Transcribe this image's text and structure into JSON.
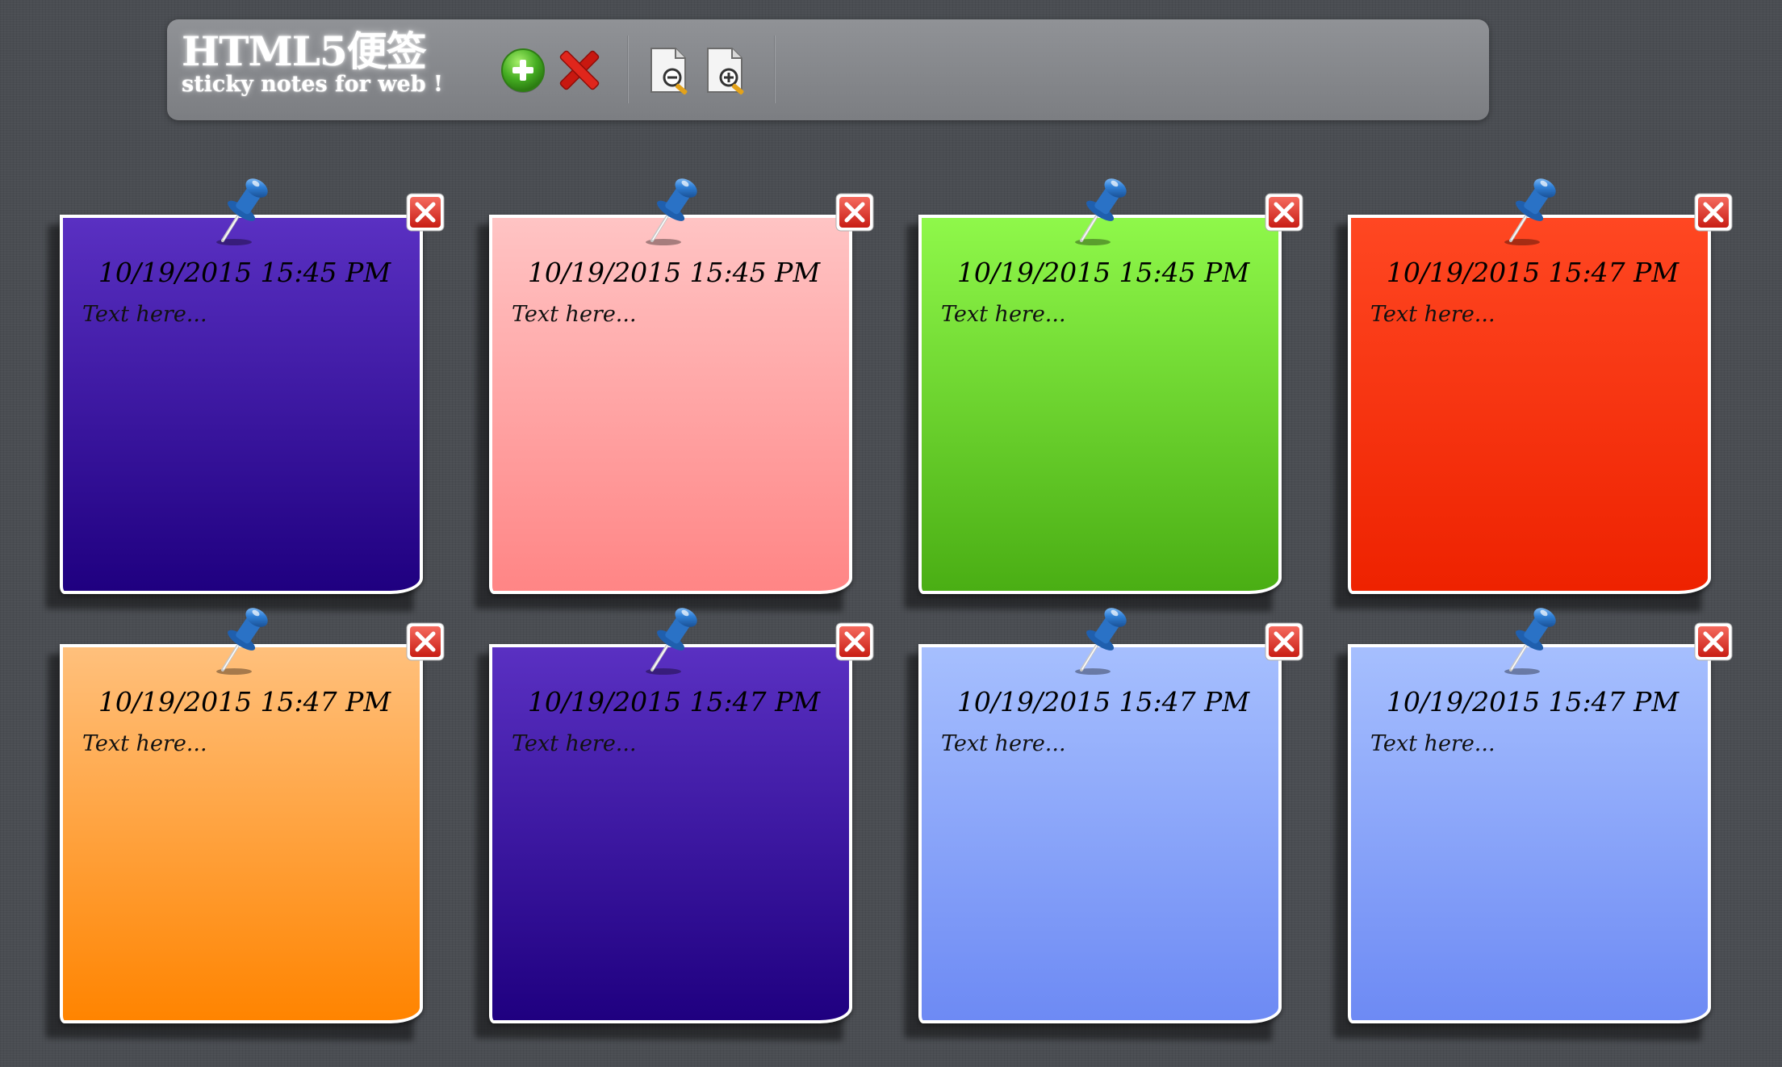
{
  "app": {
    "title": "HTML5便签",
    "subtitle": "sticky notes for web !"
  },
  "toolbar": {
    "buttons": [
      {
        "name": "add-note",
        "icon": "plus-circle-icon",
        "color": "#3aa41e"
      },
      {
        "name": "delete-all",
        "icon": "red-x-icon",
        "color": "#d8201a"
      },
      {
        "name": "zoom-out",
        "icon": "document-zoom-out-icon"
      },
      {
        "name": "zoom-in",
        "icon": "document-zoom-in-icon"
      }
    ]
  },
  "notes": [
    {
      "date": "10/19/2015 15:45 PM",
      "text": "Text here...",
      "color": "purple"
    },
    {
      "date": "10/19/2015 15:45 PM",
      "text": "Text here...",
      "color": "pink"
    },
    {
      "date": "10/19/2015 15:45 PM",
      "text": "Text here...",
      "color": "green"
    },
    {
      "date": "10/19/2015 15:47 PM",
      "text": "Text here...",
      "color": "red"
    },
    {
      "date": "10/19/2015 15:47 PM",
      "text": "Text here...",
      "color": "orange"
    },
    {
      "date": "10/19/2015 15:47 PM",
      "text": "Text here...",
      "color": "purple"
    },
    {
      "date": "10/19/2015 15:47 PM",
      "text": "Text here...",
      "color": "blue"
    },
    {
      "date": "10/19/2015 15:47 PM",
      "text": "Text here...",
      "color": "blue"
    }
  ],
  "colors": {
    "background": "#4a4d52",
    "toolbar": "#8a8c90",
    "purple": "#3a1aa8",
    "pink": "#ffa3a3",
    "green": "#6ed32e",
    "red": "#f73311",
    "orange": "#ffa040",
    "blue": "#8aa5fa",
    "pin": "#2f7fd6",
    "close": "#d9302a"
  }
}
